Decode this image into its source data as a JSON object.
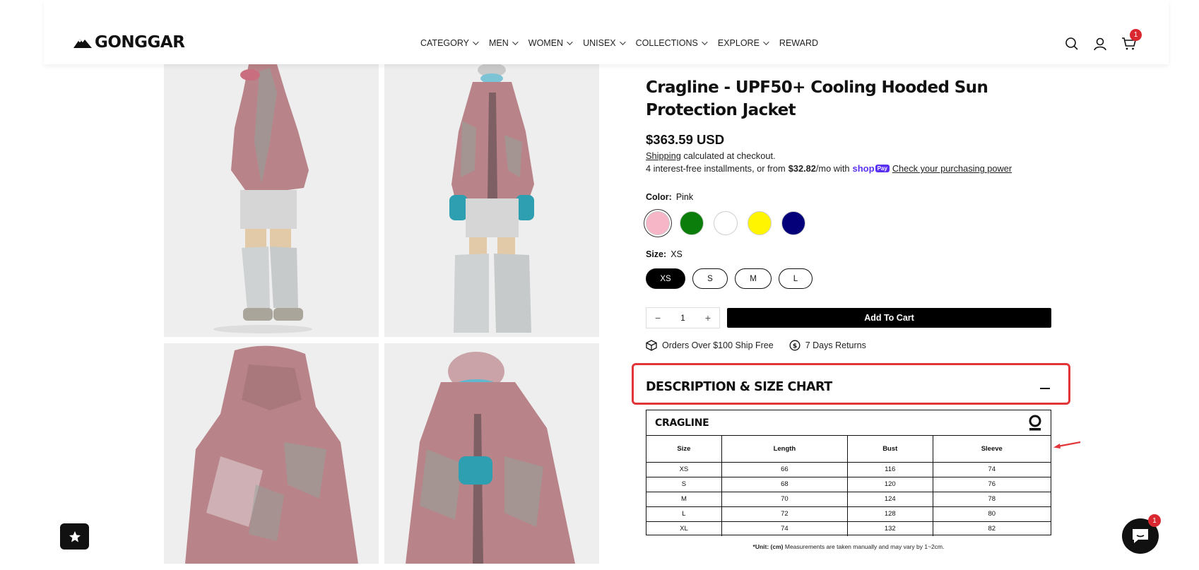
{
  "header": {
    "logo_text": "GONGGAR",
    "nav": [
      {
        "label": "CATEGORY",
        "has_dropdown": true
      },
      {
        "label": "MEN",
        "has_dropdown": true
      },
      {
        "label": "WOMEN",
        "has_dropdown": true
      },
      {
        "label": "UNISEX",
        "has_dropdown": true
      },
      {
        "label": "COLLECTIONS",
        "has_dropdown": true
      },
      {
        "label": "EXPLORE",
        "has_dropdown": true
      },
      {
        "label": "REWARD",
        "has_dropdown": false
      }
    ],
    "icons": [
      "search-icon",
      "account-icon",
      "cart-icon"
    ],
    "cart_count": "1"
  },
  "product": {
    "title": "Cragline - UPF50+ Cooling Hooded Sun Protection Jacket",
    "price": "$363.59 USD",
    "shipping_link": "Shipping",
    "shipping_text": " calculated at checkout.",
    "installments_prefix": "4 interest-free installments, or from",
    "installments_amount": "$32.82",
    "installments_suffix": "/mo with",
    "shop_pay_brand": "shop",
    "shop_pay_badge": "Pay",
    "purchasing_power_link": "Check your purchasing power",
    "color_label": "Color:",
    "color_value": "Pink",
    "colors": [
      "#f7b6c8",
      "#0a7d0a",
      "#ffffff",
      "#fff500",
      "#04007a"
    ],
    "selected_color_index": 0,
    "size_label": "Size:",
    "size_value": "XS",
    "sizes": [
      "XS",
      "S",
      "M",
      "L"
    ],
    "selected_size_index": 0,
    "quantity": "1",
    "qty_minus": "−",
    "qty_plus": "+",
    "add_to_cart": "Add To Cart",
    "perk_1": "Orders Over $100 Ship Free",
    "perk_2": "7 Days Returns"
  },
  "description": {
    "title": "DESCRIPTION & SIZE CHART",
    "highlight_color": "#e2353a"
  },
  "size_chart": {
    "brand": "CRAGLINE",
    "headers": [
      "Size",
      "Length",
      "Bust",
      "Sleeve"
    ],
    "rows": [
      [
        "XS",
        "66",
        "116",
        "74"
      ],
      [
        "S",
        "68",
        "120",
        "76"
      ],
      [
        "M",
        "70",
        "124",
        "78"
      ],
      [
        "L",
        "72",
        "128",
        "80"
      ],
      [
        "XL",
        "74",
        "132",
        "82"
      ]
    ],
    "note_bold": "*Unit: (cm)",
    "note_text": " Measurements are taken manually and may vary by 1~2cm."
  },
  "floating": {
    "chat_badge": "1",
    "reward_icon": "star-icon",
    "chat_icon": "chat-icon"
  }
}
